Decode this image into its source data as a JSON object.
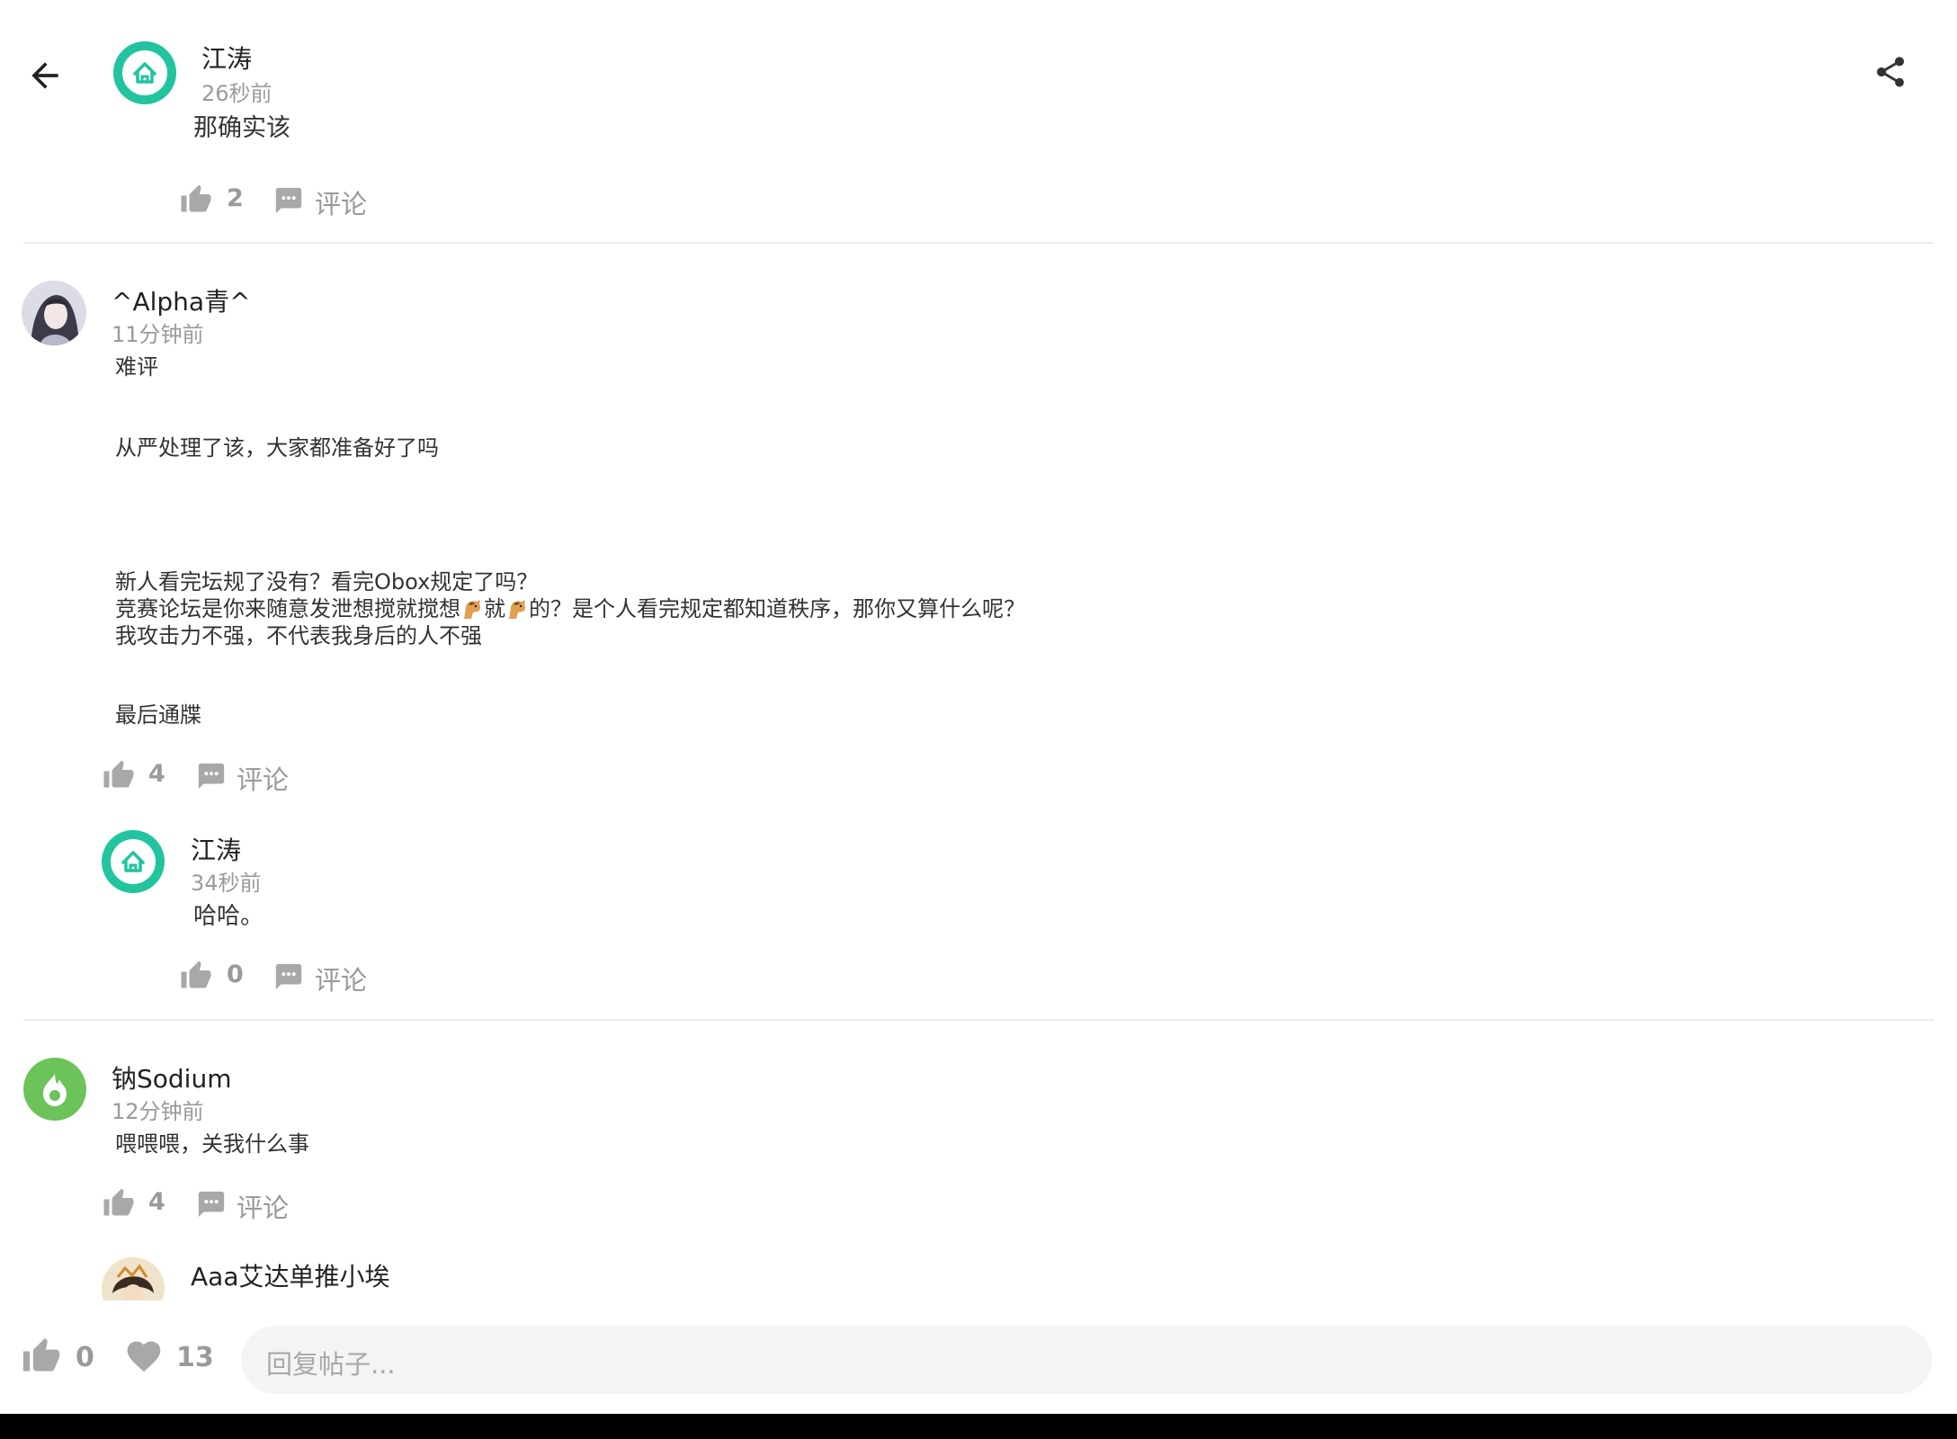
{
  "header": {
    "back_label": "",
    "share_label": ""
  },
  "post": {
    "author": "江涛",
    "time": "26秒前",
    "content": "那确实该",
    "likes": "2",
    "comment_label": "评论"
  },
  "comment1": {
    "author": "^Alpha青^",
    "time": "11分钟前",
    "line1": "难评",
    "line2": "从严处理了该，大家都准备好了吗",
    "line3": "新人看完坛规了没有？看完Obox规定了吗？",
    "line4a": "竞赛论坛是你来随意发泄想搅就搅想",
    "line4b": "就",
    "line4c": "的？是个人看完规定都知道秩序，那你又算什么呢？",
    "line5": "我攻击力不强，不代表我身后的人不强",
    "line6": "最后通牒",
    "likes": "4",
    "comment_label": "评论",
    "reply": {
      "author": "江涛",
      "time": "34秒前",
      "content": "哈哈。",
      "likes": "0",
      "comment_label": "评论"
    }
  },
  "comment2": {
    "author": "钠Sodium",
    "time": "12分钟前",
    "content": "喂喂喂，关我什么事",
    "likes": "4",
    "comment_label": "评论",
    "reply_preview": {
      "author": "Aaa艾达单推小埃"
    }
  },
  "footer": {
    "likes": "0",
    "favorites": "13",
    "reply_placeholder": "回复帖子..."
  },
  "colors": {
    "accent_green": "#22c4a0",
    "lime_green": "#6cc35a",
    "muted_gray": "#9a9a9a",
    "input_bg": "#f3f4f4"
  }
}
